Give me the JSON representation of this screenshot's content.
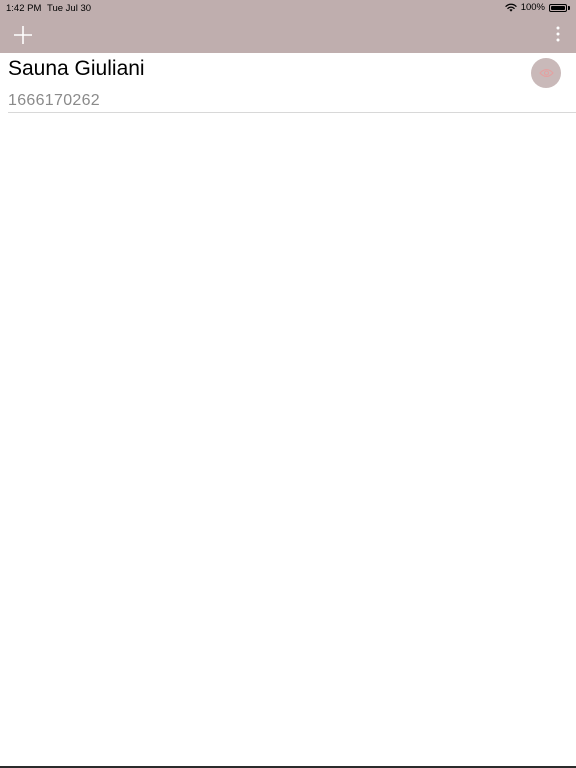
{
  "status_bar": {
    "time": "1:42 PM",
    "date": "Tue Jul 30",
    "battery": "100%",
    "icons": {
      "wifi": "wifi-icon",
      "battery": "battery-icon"
    }
  },
  "toolbar": {
    "add_icon": "plus-icon",
    "more_icon": "more-vertical-icon",
    "background_color": "#bfaeae"
  },
  "items": [
    {
      "title": "Sauna Giuliani",
      "subtitle": "1666170262",
      "action_icon": "eye-icon"
    }
  ],
  "colors": {
    "accent": "#bfaeae",
    "eye_button": "#c9b9b9",
    "eye_icon": "#e4a0a0",
    "subtitle": "#8a8a8a"
  }
}
